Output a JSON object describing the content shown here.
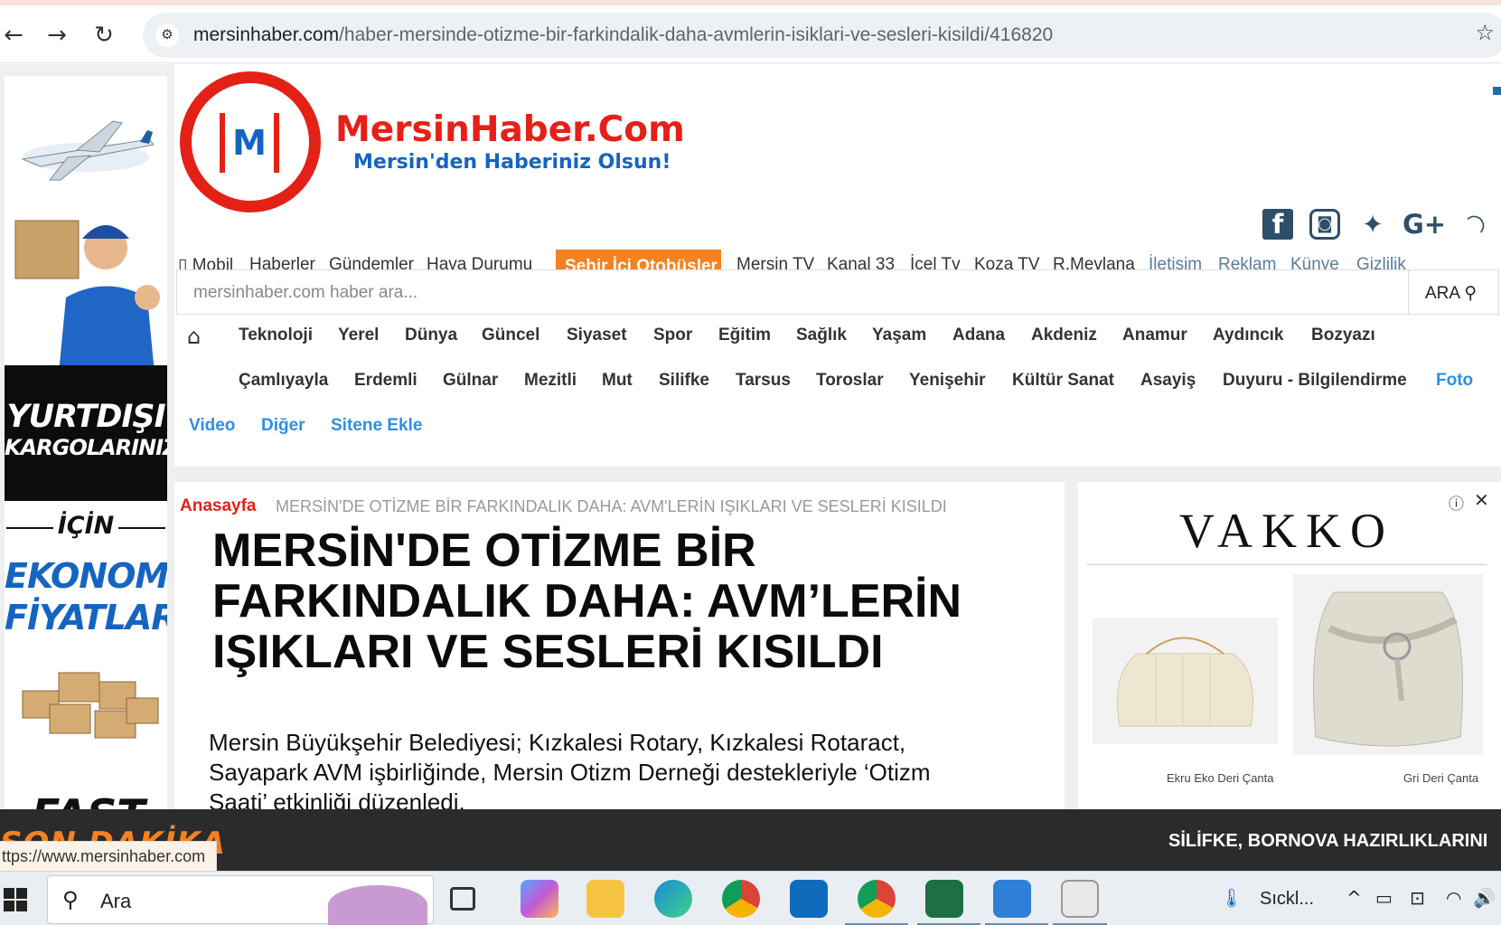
{
  "browser": {
    "url_domain": "mersinhaber.com",
    "url_path": "/haber-mersinde-otizme-bir-farkindalik-daha-avmlerin-isiklari-ve-sesleri-kisildi/416820",
    "back_icon": "←",
    "forward_icon": "→",
    "reload_icon": "↻",
    "tune_icon": "⚙",
    "star_icon": "☆"
  },
  "left_ad": {
    "line1": "YURTDIŞI",
    "line2": "KARGOLARINIZ",
    "line3": "İÇİN",
    "line4": "EKONOMİK",
    "line5": "FİYATLAR",
    "line6": "FAST"
  },
  "header": {
    "logo_letter": "M",
    "brand": "MersinHaber.Com",
    "slogan": "Mersin'den Haberiniz Olsun!",
    "social": [
      "f",
      "◙",
      "✦",
      "G+",
      "◠"
    ]
  },
  "main_nav": {
    "items": [
      "▯ Mobil",
      "Haberler",
      "Gündemler",
      "Hava Durumu",
      "Şehir İçi Otobüsler",
      "Mersin TV",
      "Kanal 33",
      "İçel Tv",
      "Koza TV",
      "R.Mevlana",
      "İletişim",
      "Reklam",
      "Künye",
      "Gizlilik"
    ]
  },
  "search": {
    "placeholder": "mersinhaber.com haber ara...",
    "button": "ARA"
  },
  "categories": {
    "row1": [
      "Teknoloji",
      "Yerel",
      "Dünya",
      "Güncel",
      "Siyaset",
      "Spor",
      "Eğitim",
      "Sağlık",
      "Yaşam",
      "Adana",
      "Akdeniz",
      "Anamur",
      "Aydıncık",
      "Bozyazı"
    ],
    "row2": [
      "Çamlıyayla",
      "Erdemli",
      "Gülnar",
      "Mezitli",
      "Mut",
      "Silifke",
      "Tarsus",
      "Toroslar",
      "Yenişehir",
      "Kültür Sanat",
      "Asayiş",
      "Duyuru - Bilgilendirme",
      "Foto"
    ],
    "row3": [
      "Video",
      "Diğer",
      "Sitene Ekle"
    ]
  },
  "article": {
    "breadcrumb_home": "Anasayfa",
    "breadcrumb_current": "MERSİN'DE OTİZME BİR FARKINDALIK DAHA: AVM'LERİN IŞIKLARI VE SESLERİ KISILDI",
    "headline": "MERSİN'DE OTİZME BİR FARKINDALIK DAHA: AVM’LERİN IŞIKLARI VE SESLERİ KISILDI",
    "lead": "Mersin Büyükşehir Belediyesi; Kızkalesi Rotary, Kızkalesi Rotaract, Sayapark AVM işbirliğinde, Mersin Otizm Derneği destekleriyle ‘Otizm Saati’ etkinliği düzenledi."
  },
  "right_ad": {
    "info": "ⓘ",
    "close": "✕",
    "brand": "VAKKO",
    "product1": "Ekru Eko Deri Çanta",
    "product2": "Gri Deri Çanta"
  },
  "ticker": {
    "label": "SON DAKİKA",
    "text": "SİLİFKE, BORNOVA HAZIRLIKLARINI"
  },
  "status_url": "ttps://www.mersinhaber.com",
  "taskbar": {
    "search_placeholder": "Ara",
    "weather": "Sıckl...",
    "tray_icons": [
      "^",
      "▭",
      "⊡",
      "◠",
      "🔊"
    ]
  }
}
